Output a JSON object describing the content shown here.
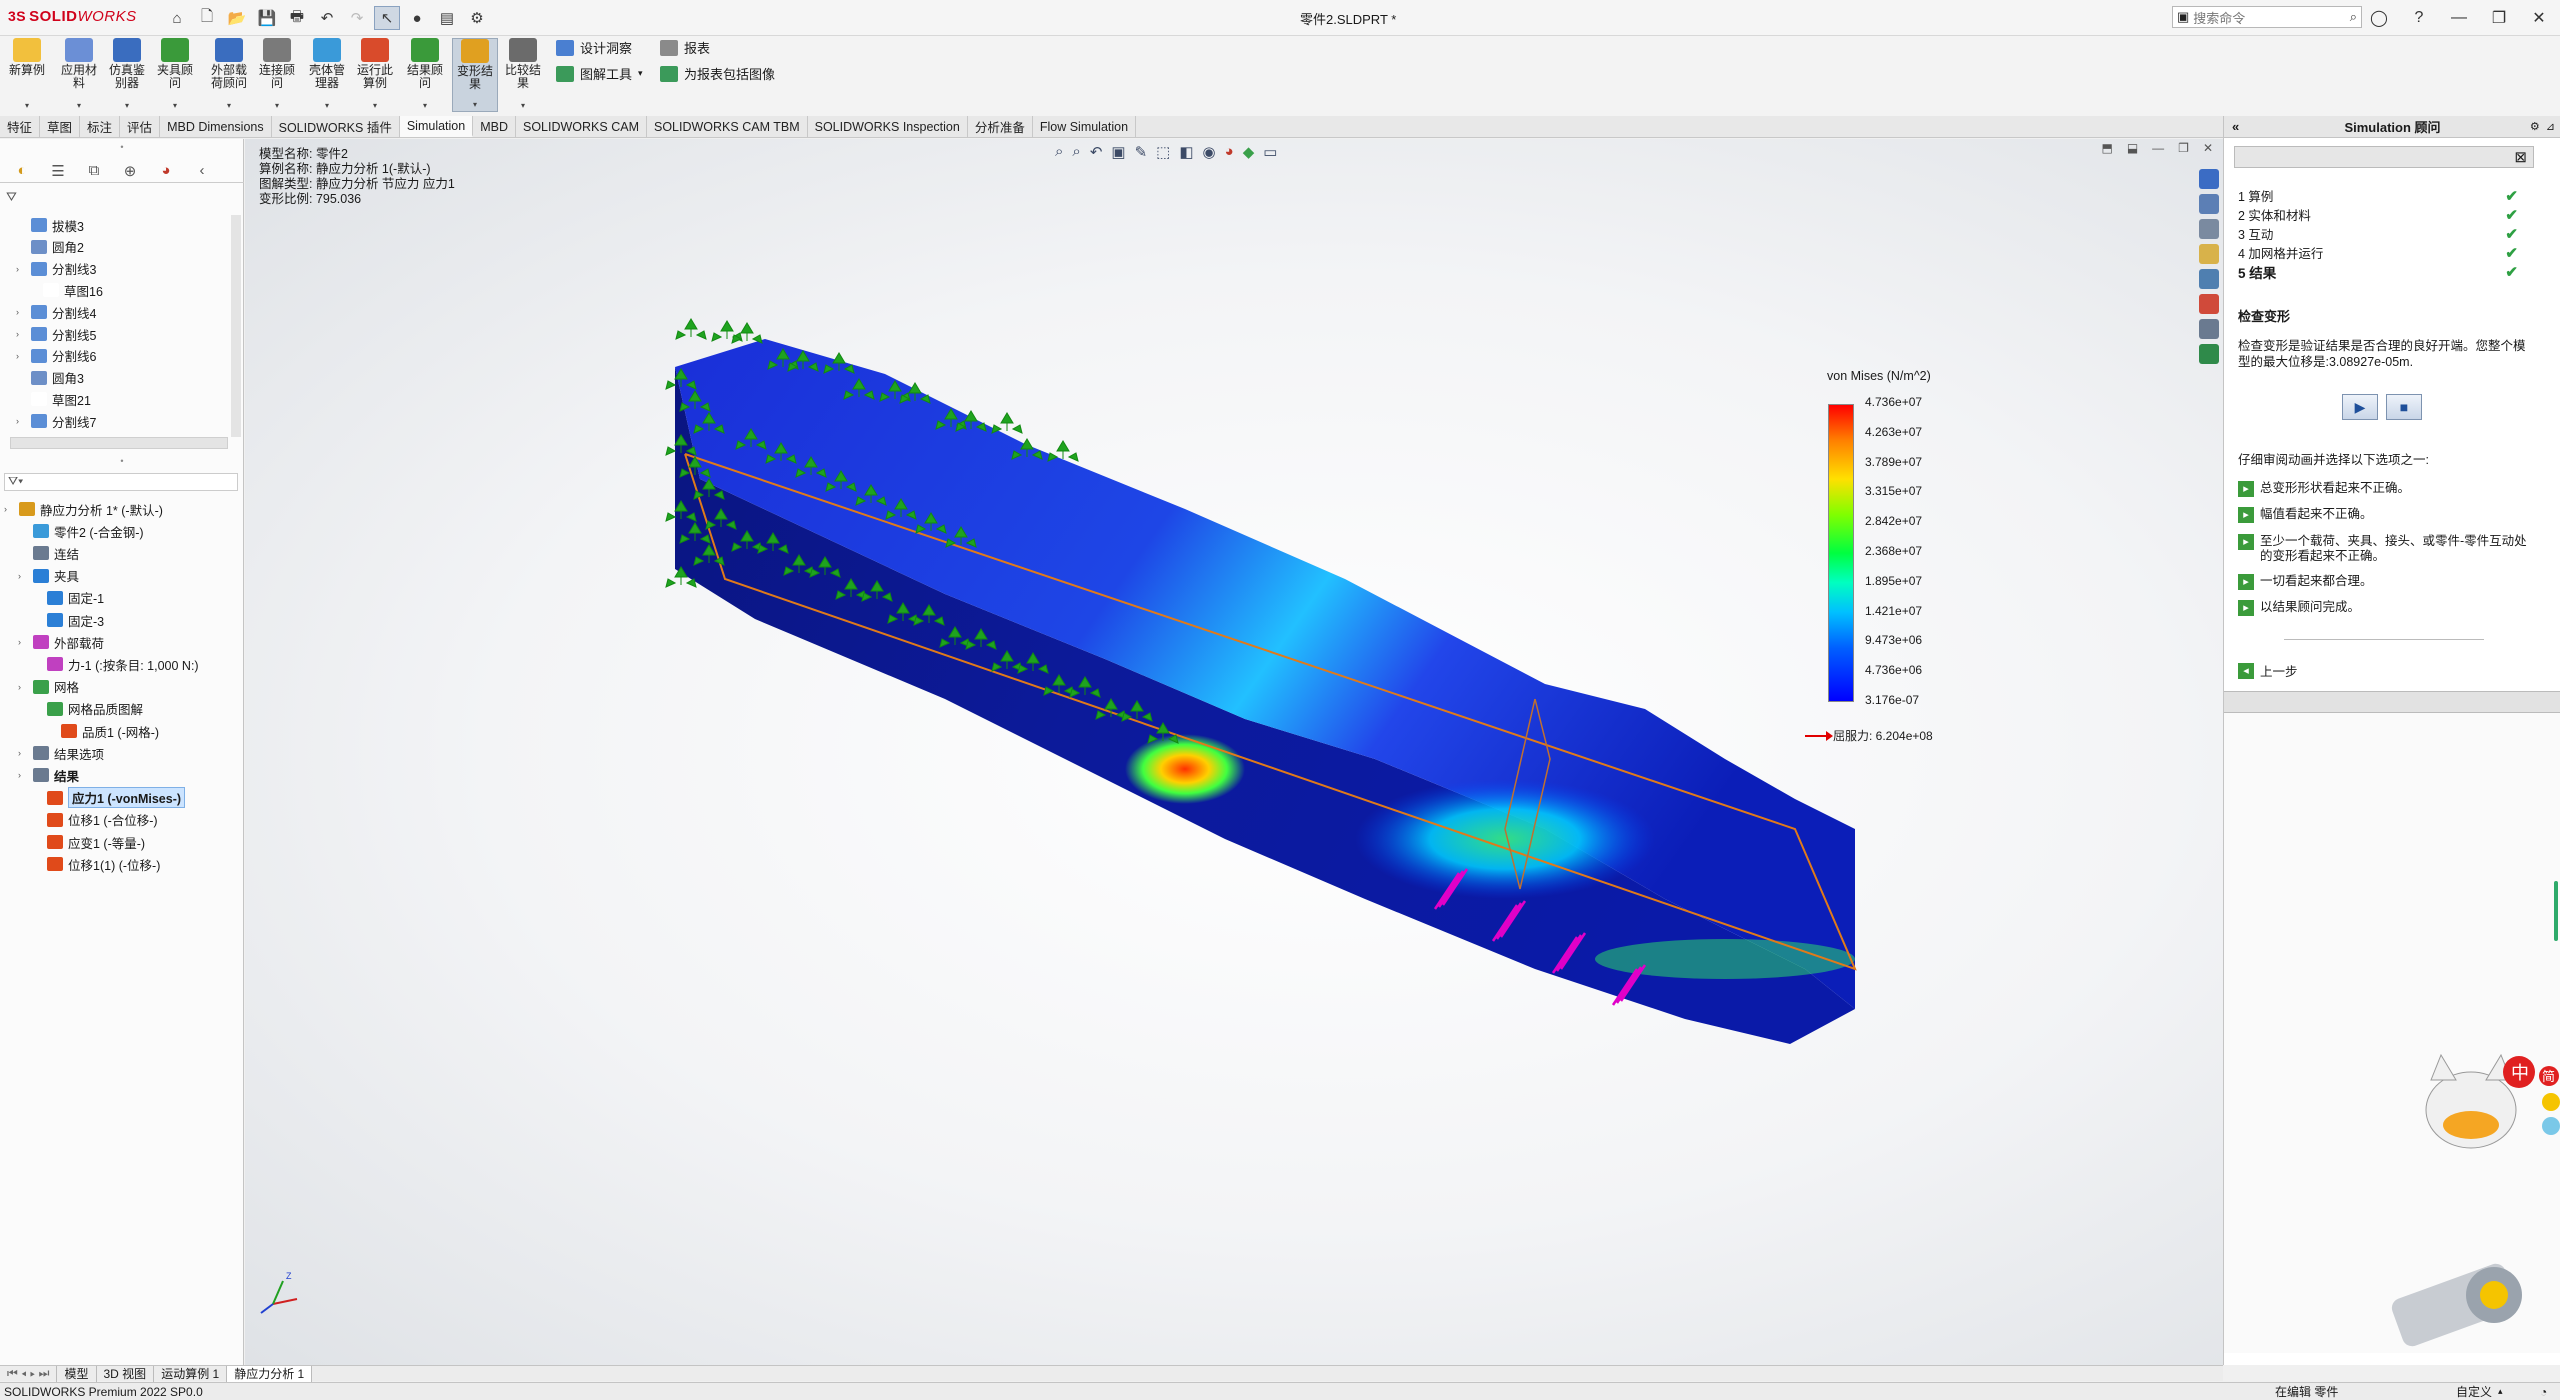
{
  "app": {
    "logo_prefix": "3S",
    "logo_bold": "SOLID",
    "logo_italic": "WORKS",
    "document_title": "零件2.SLDPRT *",
    "search_placeholder": "搜索命令"
  },
  "ribbon": {
    "buttons": [
      {
        "label": "新算例",
        "color": "#f2c03d"
      },
      {
        "label": "应用材料",
        "color": "#6b8fd6"
      },
      {
        "label": "仿真鉴别器",
        "color": "#3a6dbf"
      },
      {
        "label": "夹具顾问",
        "color": "#3a9a3a"
      },
      {
        "label": "外部载荷顾问",
        "color": "#3a6dbf"
      },
      {
        "label": "连接顾问",
        "color": "#7a7a7a"
      },
      {
        "label": "壳体管理器",
        "color": "#3a9ad9"
      },
      {
        "label": "运行此算例",
        "color": "#d94b2b"
      },
      {
        "label": "结果顾问",
        "color": "#3a9a3a"
      },
      {
        "label": "变形结果",
        "color": "#e0a020"
      },
      {
        "label": "比较结果",
        "color": "#6b6b6b"
      }
    ],
    "small": [
      {
        "label": "设计洞察"
      },
      {
        "label": "图解工具"
      },
      {
        "label": "报表"
      },
      {
        "label": "为报表包括图像"
      }
    ]
  },
  "tabs": [
    "特征",
    "草图",
    "标注",
    "评估",
    "MBD Dimensions",
    "SOLIDWORKS 插件",
    "Simulation",
    "MBD",
    "SOLIDWORKS CAM",
    "SOLIDWORKS CAM TBM",
    "SOLIDWORKS Inspection",
    "分析准备",
    "Flow Simulation"
  ],
  "active_tab": "Simulation",
  "feature_tree": [
    {
      "label": "拔模3",
      "level": 1
    },
    {
      "label": "圆角2",
      "level": 1
    },
    {
      "label": "分割线3",
      "level": 1
    },
    {
      "label": "草图16",
      "level": 2
    },
    {
      "label": "分割线4",
      "level": 1
    },
    {
      "label": "分割线5",
      "level": 1
    },
    {
      "label": "分割线6",
      "level": 1
    },
    {
      "label": "圆角3",
      "level": 1
    },
    {
      "label": "草图21",
      "level": 1
    },
    {
      "label": "分割线7",
      "level": 1
    }
  ],
  "sim_tree": [
    {
      "label": "静应力分析 1* (-默认-)",
      "level": 0
    },
    {
      "label": "零件2 (-合金钢-)",
      "level": 1
    },
    {
      "label": "连结",
      "level": 1
    },
    {
      "label": "夹具",
      "level": 1
    },
    {
      "label": "固定-1",
      "level": 2
    },
    {
      "label": "固定-3",
      "level": 2
    },
    {
      "label": "外部载荷",
      "level": 1
    },
    {
      "label": "力-1 (:按条目: 1,000 N:)",
      "level": 2
    },
    {
      "label": "网格",
      "level": 1
    },
    {
      "label": "网格品质图解",
      "level": 2
    },
    {
      "label": "品质1 (-网格-)",
      "level": 3
    },
    {
      "label": "结果选项",
      "level": 1
    },
    {
      "label": "结果",
      "level": 1
    },
    {
      "label": "应力1 (-vonMises-)",
      "level": 2
    },
    {
      "label": "位移1 (-合位移-)",
      "level": 2
    },
    {
      "label": "应变1 (-等量-)",
      "level": 2
    },
    {
      "label": "位移1(1) (-位移-)",
      "level": 2
    }
  ],
  "plot_info": {
    "model": "模型名称: 零件2",
    "study": "算例名称: 静应力分析 1(-默认-)",
    "plot": "图解类型: 静应力分析 节应力 应力1",
    "scale": "变形比例: 795.036"
  },
  "legend": {
    "title": "von Mises (N/m^2)",
    "values": [
      "4.736e+07",
      "4.263e+07",
      "3.789e+07",
      "3.315e+07",
      "2.842e+07",
      "2.368e+07",
      "1.895e+07",
      "1.421e+07",
      "9.473e+06",
      "4.736e+06",
      "3.176e-07"
    ],
    "yield": "屈服力: 6.204e+08"
  },
  "advisor": {
    "title": "Simulation 顾问",
    "steps": [
      {
        "label": "1  算例"
      },
      {
        "label": "2  实体和材料"
      },
      {
        "label": "3  互动"
      },
      {
        "label": "4  加网格并运行"
      },
      {
        "label": "5  结果"
      }
    ],
    "heading": "检查变形",
    "body": "检查变形是验证结果是否合理的良好开端。您整个模型的最大位移是:3.08927e-05m.",
    "question": "仔细审阅动画并选择以下选项之一:",
    "options": [
      "总变形形状看起来不正确。",
      "幅值看起来不正确。",
      "至少一个载荷、夹具、接头、或零件-零件互动处的变形看起来不正确。",
      "一切看起来都合理。",
      "以结果顾问完成。"
    ],
    "back": "上一步"
  },
  "bottom_tabs": [
    "模型",
    "3D 视图",
    "运动算例 1",
    "静应力分析 1"
  ],
  "active_bottom_tab": "静应力分析 1",
  "status": {
    "left": "SOLIDWORKS Premium 2022 SP0.0",
    "editing": "在编辑 零件",
    "custom": "自定义"
  },
  "colors": {
    "brand": "#d0021b",
    "stress_low": "#0000ff",
    "stress_high": "#ff0000",
    "fixture": "#1fa31f",
    "load": "#e000c8"
  }
}
